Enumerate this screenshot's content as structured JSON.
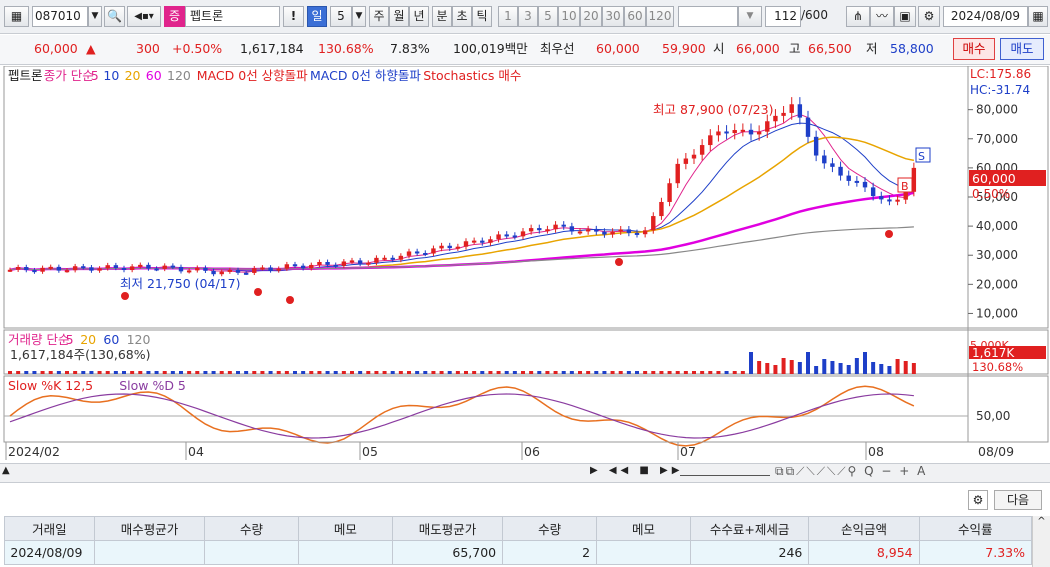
{
  "toolbar": {
    "code": "087010",
    "market_badge": "증",
    "stock_name": "펩트론",
    "alert": "!",
    "period_selected": "일",
    "period_num": "5",
    "periods": [
      "주",
      "월",
      "년",
      "분",
      "초",
      "틱"
    ],
    "ticks": [
      "1",
      "3",
      "5",
      "10",
      "20",
      "30",
      "60",
      "120"
    ],
    "count": "112",
    "count_max": "/600",
    "date": "2024/08/09"
  },
  "quote": {
    "price": "60,000",
    "arrow": "▲",
    "change": "300",
    "change_pct": "+0.50%",
    "volume": "1,617,184",
    "vol_ratio": "130.68%",
    "turnover": "7.83%",
    "amount": "100,019백만",
    "best_label": "최우선",
    "ask": "60,000",
    "bid": "59,900",
    "open_label": "시",
    "open": "66,000",
    "high_label": "고",
    "high": "66,500",
    "low_label": "저",
    "low": "58,800",
    "buy": "매수",
    "sell": "매도"
  },
  "price_panel": {
    "legend": [
      {
        "label": "펩트론",
        "color": "#222"
      },
      {
        "label": "종가 단순",
        "color": "#e0248c"
      },
      {
        "label": "5",
        "color": "#e0248c"
      },
      {
        "label": "10",
        "color": "#1e3fc8"
      },
      {
        "label": "20",
        "color": "#e8a400"
      },
      {
        "label": "60",
        "color": "#e000e0"
      },
      {
        "label": "120",
        "color": "#888"
      },
      {
        "label": "MACD 0선 상향돌파",
        "color": "#e02020"
      },
      {
        "label": "MACD 0선 하향돌파",
        "color": "#1e3fc8"
      },
      {
        "label": "Stochastics 매수",
        "color": "#e02020"
      }
    ],
    "lc": "LC:175.86",
    "hc": "HC:-31.74",
    "high_note": "최고 87,900 (07/23)",
    "low_note": "최저 21,750 (04/17)",
    "last_price": "60,000",
    "last_pct": "0.50%",
    "signal_s": "S",
    "signal_b": "B"
  },
  "volume_panel": {
    "legend": [
      {
        "label": "거래량 단순",
        "color": "#e0248c"
      },
      {
        "label": "5",
        "color": "#e0248c"
      },
      {
        "label": "20",
        "color": "#e8a400"
      },
      {
        "label": "60",
        "color": "#1e3fc8"
      },
      {
        "label": "120",
        "color": "#888"
      }
    ],
    "info": "1,617,184주(130,68%)",
    "last_vol": "1,617K",
    "last_pct": "130.68%",
    "top_label": "5,000K"
  },
  "stoch_panel": {
    "legend": [
      {
        "label": "Slow %K 12,5",
        "color": "#e02020"
      },
      {
        "label": "Slow %D 5",
        "color": "#8a3ca0"
      }
    ],
    "level": "50,00"
  },
  "x_axis": {
    "labels": [
      "2024/02",
      "04",
      "05",
      "06",
      "07",
      "08"
    ],
    "right": "08/09"
  },
  "next_btn": "다음",
  "table": {
    "headers": [
      "거래일",
      "매수평균가",
      "수량",
      "메모",
      "매도평균가",
      "수량",
      "메모",
      "수수료+제세금",
      "손익금액",
      "수익률"
    ],
    "row": [
      "2024/08/09",
      "",
      "",
      "",
      "65,700",
      "2",
      "",
      "246",
      "8,954",
      "7.33%"
    ]
  },
  "chart_data": {
    "type": "candlestick",
    "title": "펩트론",
    "y_ticks": [
      10000,
      20000,
      30000,
      40000,
      50000,
      60000,
      70000,
      80000
    ],
    "ylim": [
      5000,
      95000
    ],
    "highest": {
      "value": 87900,
      "date": "07/23"
    },
    "lowest": {
      "value": 21750,
      "date": "04/17"
    },
    "last_close": 60000,
    "x_labels": [
      "2024/02",
      "04",
      "05",
      "06",
      "07",
      "08"
    ]
  }
}
